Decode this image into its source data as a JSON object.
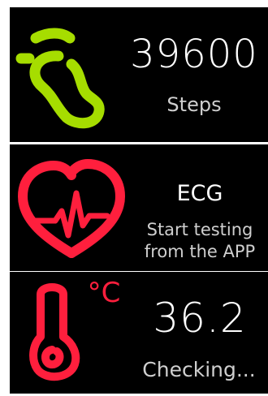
{
  "steps": {
    "value": "39600",
    "label": "Steps",
    "icon": "footprint-icon",
    "color": "#a6dd00"
  },
  "ecg": {
    "title": "ECG",
    "line1": "Start testing",
    "line2": "from the APP",
    "icon": "heart-ecg-icon",
    "color": "#ff1f3d"
  },
  "temperature": {
    "value": "36.2",
    "unit": "°C",
    "label": "Checking...",
    "icon": "thermometer-icon",
    "color": "#ff1f3d"
  }
}
